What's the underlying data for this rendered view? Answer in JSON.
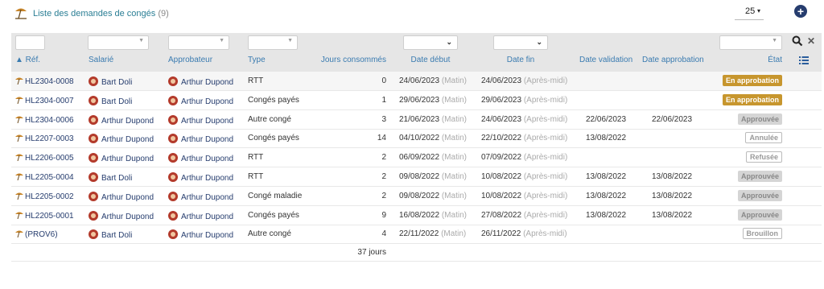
{
  "header": {
    "title": "Liste des demandes de congés",
    "count": "(9)",
    "limit": "25",
    "limit_caret": "▾",
    "add_icon": "+"
  },
  "columns": {
    "ref": "▲ Réf.",
    "salarie": "Salarié",
    "approbateur": "Approbateur",
    "type": "Type",
    "jours": "Jours consommés",
    "date_debut": "Date début",
    "date_fin": "Date fin",
    "date_validation": "Date validation",
    "date_approbation": "Date approbation",
    "etat": "État"
  },
  "icons": {
    "title": "beach-umbrella-icon",
    "ref": "beach-umbrella-icon",
    "search": "search-icon",
    "clear": "close-icon",
    "menu": "list-icon",
    "avatar": "user-avatar-icon"
  },
  "rows": [
    {
      "ref": "HL2304-0008",
      "salarie": "Bart Doli",
      "approbateur": "Arthur Dupond",
      "type": "RTT",
      "jours": "0",
      "debut": "24/06/2023",
      "debut_period": "(Matin)",
      "fin": "24/06/2023",
      "fin_period": "(Après-midi)",
      "validation": "",
      "approbation": "",
      "etat": "En approbation",
      "etat_style": "approbation"
    },
    {
      "ref": "HL2304-0007",
      "salarie": "Bart Doli",
      "approbateur": "Arthur Dupond",
      "type": "Congés payés",
      "jours": "1",
      "debut": "29/06/2023",
      "debut_period": "(Matin)",
      "fin": "29/06/2023",
      "fin_period": "(Après-midi)",
      "validation": "",
      "approbation": "",
      "etat": "En approbation",
      "etat_style": "approbation"
    },
    {
      "ref": "HL2304-0006",
      "salarie": "Arthur Dupond",
      "approbateur": "Arthur Dupond",
      "type": "Autre congé",
      "jours": "3",
      "debut": "21/06/2023",
      "debut_period": "(Matin)",
      "fin": "24/06/2023",
      "fin_period": "(Après-midi)",
      "validation": "22/06/2023",
      "approbation": "22/06/2023",
      "etat": "Approuvée",
      "etat_style": "approuvee"
    },
    {
      "ref": "HL2207-0003",
      "salarie": "Arthur Dupond",
      "approbateur": "Arthur Dupond",
      "type": "Congés payés",
      "jours": "14",
      "debut": "04/10/2022",
      "debut_period": "(Matin)",
      "fin": "22/10/2022",
      "fin_period": "(Après-midi)",
      "validation": "13/08/2022",
      "approbation": "",
      "etat": "Annulée",
      "etat_style": "annulee"
    },
    {
      "ref": "HL2206-0005",
      "salarie": "Arthur Dupond",
      "approbateur": "Arthur Dupond",
      "type": "RTT",
      "jours": "2",
      "debut": "06/09/2022",
      "debut_period": "(Matin)",
      "fin": "07/09/2022",
      "fin_period": "(Après-midi)",
      "validation": "",
      "approbation": "",
      "etat": "Refusée",
      "etat_style": "refusee"
    },
    {
      "ref": "HL2205-0004",
      "salarie": "Bart Doli",
      "approbateur": "Arthur Dupond",
      "type": "RTT",
      "jours": "2",
      "debut": "09/08/2022",
      "debut_period": "(Matin)",
      "fin": "10/08/2022",
      "fin_period": "(Après-midi)",
      "validation": "13/08/2022",
      "approbation": "13/08/2022",
      "etat": "Approuvée",
      "etat_style": "approuvee"
    },
    {
      "ref": "HL2205-0002",
      "salarie": "Arthur Dupond",
      "approbateur": "Arthur Dupond",
      "type": "Congé maladie",
      "jours": "2",
      "debut": "09/08/2022",
      "debut_period": "(Matin)",
      "fin": "10/08/2022",
      "fin_period": "(Après-midi)",
      "validation": "13/08/2022",
      "approbation": "13/08/2022",
      "etat": "Approuvée",
      "etat_style": "approuvee"
    },
    {
      "ref": "HL2205-0001",
      "salarie": "Arthur Dupond",
      "approbateur": "Arthur Dupond",
      "type": "Congés payés",
      "jours": "9",
      "debut": "16/08/2022",
      "debut_period": "(Matin)",
      "fin": "27/08/2022",
      "fin_period": "(Après-midi)",
      "validation": "13/08/2022",
      "approbation": "13/08/2022",
      "etat": "Approuvée",
      "etat_style": "approuvee"
    },
    {
      "ref": "(PROV6)",
      "salarie": "Bart Doli",
      "approbateur": "Arthur Dupond",
      "type": "Autre congé",
      "jours": "4",
      "debut": "22/11/2022",
      "debut_period": "(Matin)",
      "fin": "26/11/2022",
      "fin_period": "(Après-midi)",
      "validation": "",
      "approbation": "",
      "etat": "Brouillon",
      "etat_style": "brouillon"
    }
  ],
  "footer": {
    "total": "37 jours"
  }
}
